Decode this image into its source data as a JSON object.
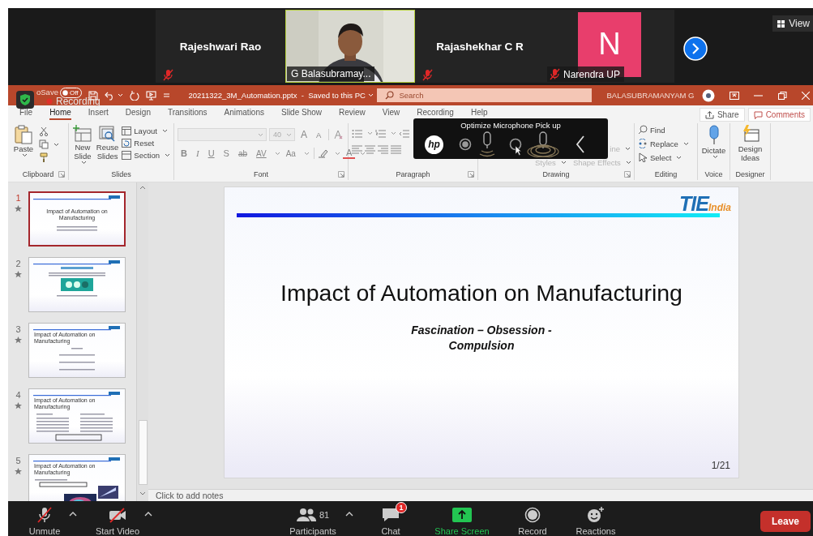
{
  "meeting": {
    "tiles": [
      {
        "kind": "name",
        "name": "Rajeshwari Rao",
        "muted": true
      },
      {
        "kind": "video",
        "name": "G Balasubramay...",
        "muted": false
      },
      {
        "kind": "name",
        "name": "Rajashekhar C R",
        "muted": true
      },
      {
        "kind": "avatar",
        "initial": "N",
        "name": "Narendra UP",
        "muted": true,
        "color": "#e83e6c"
      }
    ],
    "view_label": "View"
  },
  "recording_indicator": {
    "label": "Recording"
  },
  "title_bar": {
    "autosave_label": "oSave",
    "autosave_toggle": {
      "label": "Off",
      "on": false
    },
    "file_title": "20211322_3M_Automation.pptx  -  Saved to this PC",
    "search": {
      "placeholder": "Search"
    },
    "user_name": "BALASUBRAMANYAM G"
  },
  "ribbon_tabs": [
    {
      "label": "File",
      "selected": false
    },
    {
      "label": "Home",
      "selected": true
    },
    {
      "label": "Insert",
      "selected": false
    },
    {
      "label": "Design",
      "selected": false
    },
    {
      "label": "Transitions",
      "selected": false
    },
    {
      "label": "Animations",
      "selected": false
    },
    {
      "label": "Slide Show",
      "selected": false
    },
    {
      "label": "Review",
      "selected": false
    },
    {
      "label": "View",
      "selected": false
    },
    {
      "label": "Recording",
      "selected": false
    },
    {
      "label": "Help",
      "selected": false
    }
  ],
  "share_label": "Share",
  "comments_label": "Comments",
  "ribbon_groups": [
    {
      "label": "Clipboard",
      "items": [
        {
          "label": "Paste"
        }
      ]
    },
    {
      "label": "Slides",
      "items": [
        {
          "label": "New Slide"
        },
        {
          "label": "Reuse Slides"
        },
        {
          "label": "Layout"
        },
        {
          "label": "Reset"
        },
        {
          "label": "Section"
        }
      ]
    },
    {
      "label": "Font",
      "font_size": "40",
      "items": [
        {
          "kind": "grow",
          "label": "A"
        },
        {
          "kind": "shrink",
          "label": "A"
        },
        {
          "kind": "bold",
          "label": "B"
        },
        {
          "kind": "italic",
          "label": "I"
        },
        {
          "kind": "underline",
          "label": "U"
        },
        {
          "kind": "shadow",
          "label": "S"
        },
        {
          "kind": "strike",
          "label": "ab"
        },
        {
          "kind": "spacing",
          "label": "AV"
        },
        {
          "kind": "case",
          "label": "Aa"
        },
        {
          "kind": "color",
          "label": "A"
        }
      ]
    },
    {
      "label": "Paragraph"
    },
    {
      "label": "Drawing",
      "items": [
        {
          "label": "ine"
        },
        {
          "label": "Styles"
        },
        {
          "label": "Shape Effects"
        }
      ]
    },
    {
      "label": "Editing",
      "items": [
        {
          "label": "Find"
        },
        {
          "label": "Replace"
        },
        {
          "label": "Select"
        }
      ]
    },
    {
      "label": "Voice",
      "items": [
        {
          "label": "Dictate"
        }
      ]
    },
    {
      "label": "Designer",
      "items": [
        {
          "label": "Design Ideas"
        }
      ]
    }
  ],
  "mic_overlay": {
    "brand": "hp",
    "title": "Optimize Microphone Pick up",
    "modes": [
      {
        "selected": true
      },
      {
        "selected": false
      }
    ]
  },
  "slide_thumbnails": [
    {
      "number": "1",
      "kind": "title",
      "title": "Impact of Automation on Manufacturing",
      "selected": true
    },
    {
      "number": "2",
      "kind": "media",
      "selected": false
    },
    {
      "number": "3",
      "kind": "list",
      "title": "Impact of Automation on Manufacturing",
      "selected": false
    },
    {
      "number": "4",
      "kind": "columns",
      "title": "Impact of Automation on Manufacturing",
      "selected": false
    },
    {
      "number": "5",
      "kind": "pictures",
      "title": "Impact of Automation on Manufacturing",
      "selected": false
    }
  ],
  "slide": {
    "logo": {
      "primary": "TIE",
      "secondary": "India"
    },
    "title": "Impact of Automation on Manufacturing",
    "subtitle": "Fascination – Obsession - Compulsion",
    "page": "1/21"
  },
  "notes_placeholder": "Click to add notes",
  "controls": [
    {
      "kind": "mic",
      "label": "Unmute",
      "caret": true
    },
    {
      "kind": "video",
      "label": "Start Video",
      "caret": true
    },
    {
      "kind": "participants",
      "label": "Participants",
      "count": "81",
      "caret": true
    },
    {
      "kind": "chat",
      "label": "Chat",
      "badge": "1",
      "caret": false
    },
    {
      "kind": "share",
      "label": "Share Screen",
      "caret": false
    },
    {
      "kind": "record",
      "label": "Record",
      "caret": false
    },
    {
      "kind": "reactions",
      "label": "Reactions",
      "caret": false
    }
  ],
  "leave_label": "Leave"
}
